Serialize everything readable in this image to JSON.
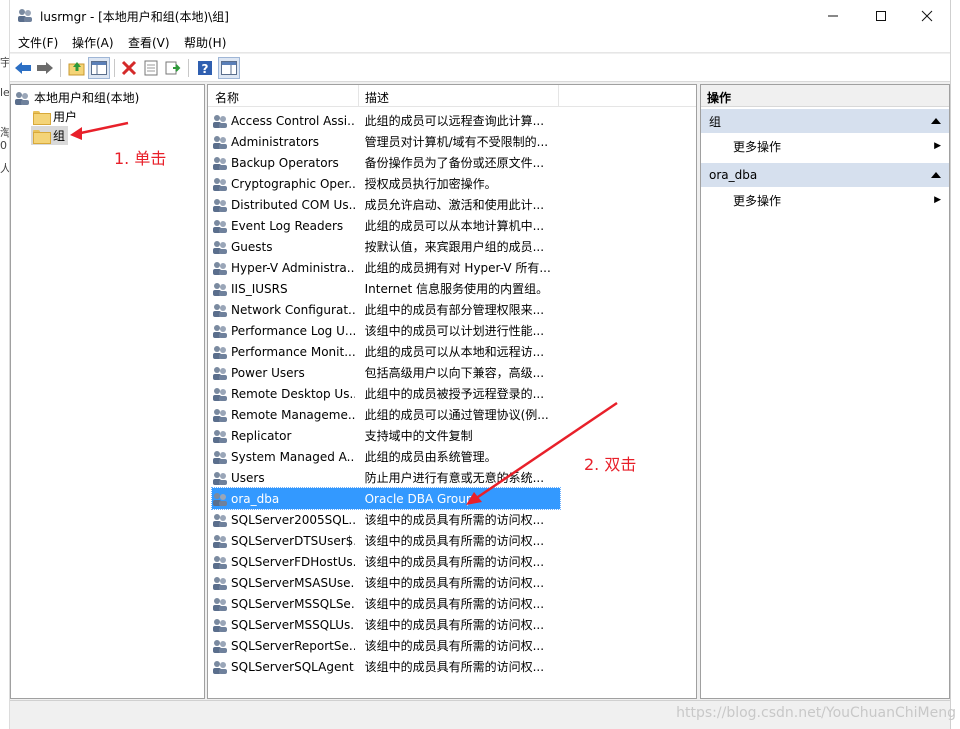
{
  "window": {
    "title": "lusrmgr - [本地用户和组(本地)\\组]",
    "controls": [
      "minimize",
      "maximize",
      "close"
    ]
  },
  "background_fragments": [
    "宇",
    "le",
    "0",
    "淘",
    "人"
  ],
  "menu": [
    "文件(F)",
    "操作(A)",
    "查看(V)",
    "帮助(H)"
  ],
  "toolbar_icons": [
    "back-icon",
    "forward-icon",
    "up-folder-icon",
    "show-tree-icon",
    "delete-icon",
    "properties-icon",
    "export-icon",
    "help-icon",
    "action-pane-icon"
  ],
  "tree": {
    "root": "本地用户和组(本地)",
    "children": [
      "用户",
      "组"
    ],
    "selected": "组"
  },
  "list": {
    "columns": [
      "名称",
      "描述"
    ],
    "rows": [
      {
        "name": "Access Control Assi...",
        "desc": "此组的成员可以远程查询此计算..."
      },
      {
        "name": "Administrators",
        "desc": "管理员对计算机/域有不受限制的..."
      },
      {
        "name": "Backup Operators",
        "desc": "备份操作员为了备份或还原文件..."
      },
      {
        "name": "Cryptographic Oper...",
        "desc": "授权成员执行加密操作。"
      },
      {
        "name": "Distributed COM Us...",
        "desc": "成员允许启动、激活和使用此计..."
      },
      {
        "name": "Event Log Readers",
        "desc": "此组的成员可以从本地计算机中..."
      },
      {
        "name": "Guests",
        "desc": "按默认值，来宾跟用户组的成员..."
      },
      {
        "name": "Hyper-V Administra...",
        "desc": "此组的成员拥有对 Hyper-V 所有..."
      },
      {
        "name": "IIS_IUSRS",
        "desc": "Internet 信息服务使用的内置组。"
      },
      {
        "name": "Network Configurat...",
        "desc": "此组中的成员有部分管理权限来..."
      },
      {
        "name": "Performance Log U...",
        "desc": "该组中的成员可以计划进行性能..."
      },
      {
        "name": "Performance Monit...",
        "desc": "此组的成员可以从本地和远程访..."
      },
      {
        "name": "Power Users",
        "desc": "包括高级用户以向下兼容，高级..."
      },
      {
        "name": "Remote Desktop Us...",
        "desc": "此组中的成员被授予远程登录的..."
      },
      {
        "name": "Remote Manageme...",
        "desc": "此组的成员可以通过管理协议(例..."
      },
      {
        "name": "Replicator",
        "desc": "支持域中的文件复制"
      },
      {
        "name": "System Managed A...",
        "desc": "此组的成员由系统管理。"
      },
      {
        "name": "Users",
        "desc": "防止用户进行有意或无意的系统..."
      },
      {
        "name": "ora_dba",
        "desc": "Oracle DBA Group",
        "selected": true
      },
      {
        "name": "SQLServer2005SQL...",
        "desc": "该组中的成员具有所需的访问权..."
      },
      {
        "name": "SQLServerDTSUser$...",
        "desc": "该组中的成员具有所需的访问权..."
      },
      {
        "name": "SQLServerFDHostUs...",
        "desc": "该组中的成员具有所需的访问权..."
      },
      {
        "name": "SQLServerMSASUse...",
        "desc": "该组中的成员具有所需的访问权..."
      },
      {
        "name": "SQLServerMSSQLSe...",
        "desc": "该组中的成员具有所需的访问权..."
      },
      {
        "name": "SQLServerMSSQLUs...",
        "desc": "该组中的成员具有所需的访问权..."
      },
      {
        "name": "SQLServerReportSe...",
        "desc": "该组中的成员具有所需的访问权..."
      },
      {
        "name": "SQLServerSQLAgent...",
        "desc": "该组中的成员具有所需的访问权..."
      }
    ]
  },
  "actions": {
    "title": "操作",
    "groups": [
      {
        "label": "组",
        "item": "更多操作"
      },
      {
        "label": "ora_dba",
        "item": "更多操作"
      }
    ]
  },
  "annotations": {
    "step1": "1. 单击",
    "step2": "2. 双击",
    "color": "#e8202a"
  },
  "watermark": "https://blog.csdn.net/YouChuanChiMeng"
}
